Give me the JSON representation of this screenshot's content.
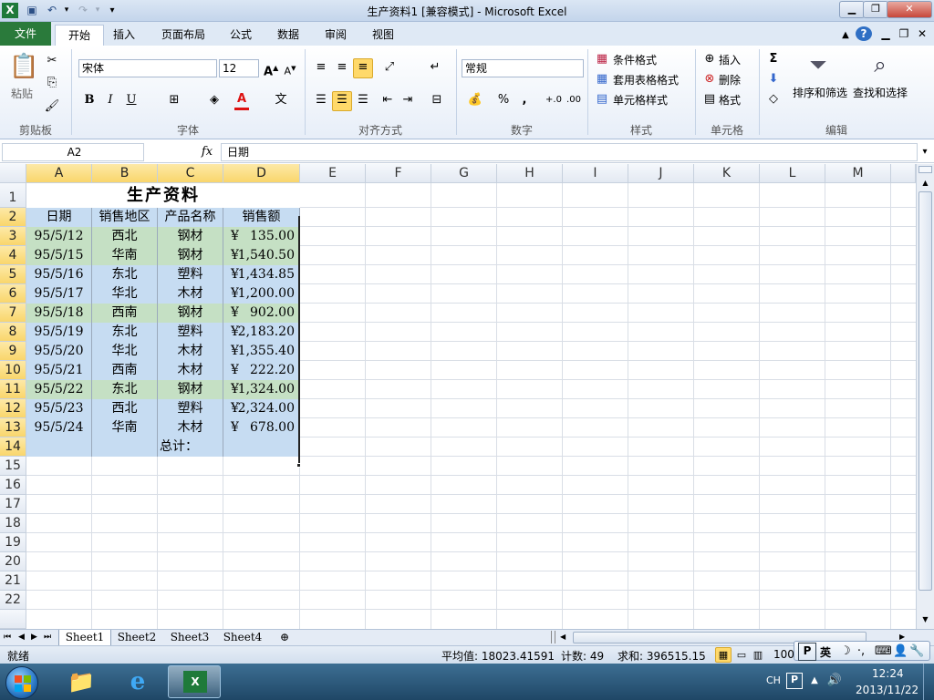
{
  "window": {
    "title": "生产资料1  [兼容模式] - Microsoft Excel",
    "app_icon": "excel-icon"
  },
  "ribbon_tabs": [
    "文件",
    "开始",
    "插入",
    "页面布局",
    "公式",
    "数据",
    "审阅",
    "视图"
  ],
  "ribbon": {
    "clipboard": {
      "paste": "粘贴",
      "label": "剪贴板"
    },
    "font": {
      "name": "宋体",
      "size": "12",
      "label": "字体",
      "bold": "B",
      "italic": "I",
      "underline": "U",
      "color_a": "A"
    },
    "alignment": {
      "label": "对齐方式"
    },
    "number": {
      "format": "常规",
      "percent": "%",
      "comma": ",",
      "label": "数字"
    },
    "styles": {
      "conditional": "条件格式",
      "table": "套用表格格式",
      "cell_styles": "单元格样式",
      "label": "样式"
    },
    "cells": {
      "insert": "插入",
      "delete": "删除",
      "format": "格式",
      "label": "单元格"
    },
    "editing": {
      "sigma": "Σ",
      "sort": "排序和筛选",
      "find": "查找和选择",
      "label": "编辑"
    }
  },
  "formula_bar": {
    "name_box": "A2",
    "fx": "fx",
    "content": "日期"
  },
  "columns": [
    "A",
    "B",
    "C",
    "D",
    "E",
    "F",
    "G",
    "H",
    "I",
    "J",
    "K",
    "L",
    "M"
  ],
  "rows": [
    "1",
    "2",
    "3",
    "4",
    "5",
    "6",
    "7",
    "8",
    "9",
    "10",
    "11",
    "12",
    "13",
    "14",
    "15",
    "16",
    "17",
    "18",
    "19",
    "20",
    "21",
    "22"
  ],
  "sheet": {
    "title": "生产资料",
    "headers": [
      "日期",
      "销售地区",
      "产品名称",
      "销售额"
    ],
    "records": [
      {
        "date": "95/5/12",
        "region": "西北",
        "product": "钢材",
        "yen": "¥",
        "amount": "135.00"
      },
      {
        "date": "95/5/15",
        "region": "华南",
        "product": "钢材",
        "yen": "¥",
        "amount": "1,540.50"
      },
      {
        "date": "95/5/16",
        "region": "东北",
        "product": "塑料",
        "yen": "¥",
        "amount": "1,434.85"
      },
      {
        "date": "95/5/17",
        "region": "华北",
        "product": "木材",
        "yen": "¥",
        "amount": "1,200.00"
      },
      {
        "date": "95/5/18",
        "region": "西南",
        "product": "钢材",
        "yen": "¥",
        "amount": "902.00"
      },
      {
        "date": "95/5/19",
        "region": "东北",
        "product": "塑料",
        "yen": "¥",
        "amount": "2,183.20"
      },
      {
        "date": "95/5/20",
        "region": "华北",
        "product": "木材",
        "yen": "¥",
        "amount": "1,355.40"
      },
      {
        "date": "95/5/21",
        "region": "西南",
        "product": "木材",
        "yen": "¥",
        "amount": "222.20"
      },
      {
        "date": "95/5/22",
        "region": "东北",
        "product": "钢材",
        "yen": "¥",
        "amount": "1,324.00"
      },
      {
        "date": "95/5/23",
        "region": "西北",
        "product": "塑料",
        "yen": "¥",
        "amount": "2,324.00"
      },
      {
        "date": "95/5/24",
        "region": "华南",
        "product": "木材",
        "yen": "¥",
        "amount": "678.00"
      }
    ],
    "total_label": "总计：",
    "colors": {
      "green_row": "#c5e0c4",
      "blue_row": "#c6dcf2"
    }
  },
  "sheet_tabs": [
    "Sheet1",
    "Sheet2",
    "Sheet3",
    "Sheet4"
  ],
  "status_bar": {
    "ready": "就绪",
    "average": "平均值: 18023.41591",
    "count": "计数: 49",
    "sum": "求和: 396515.15",
    "zoom": "100"
  },
  "ime": {
    "lang": "英"
  },
  "taskbar": {
    "lang": "CH",
    "time": "12:24",
    "date": "2013/11/22"
  }
}
